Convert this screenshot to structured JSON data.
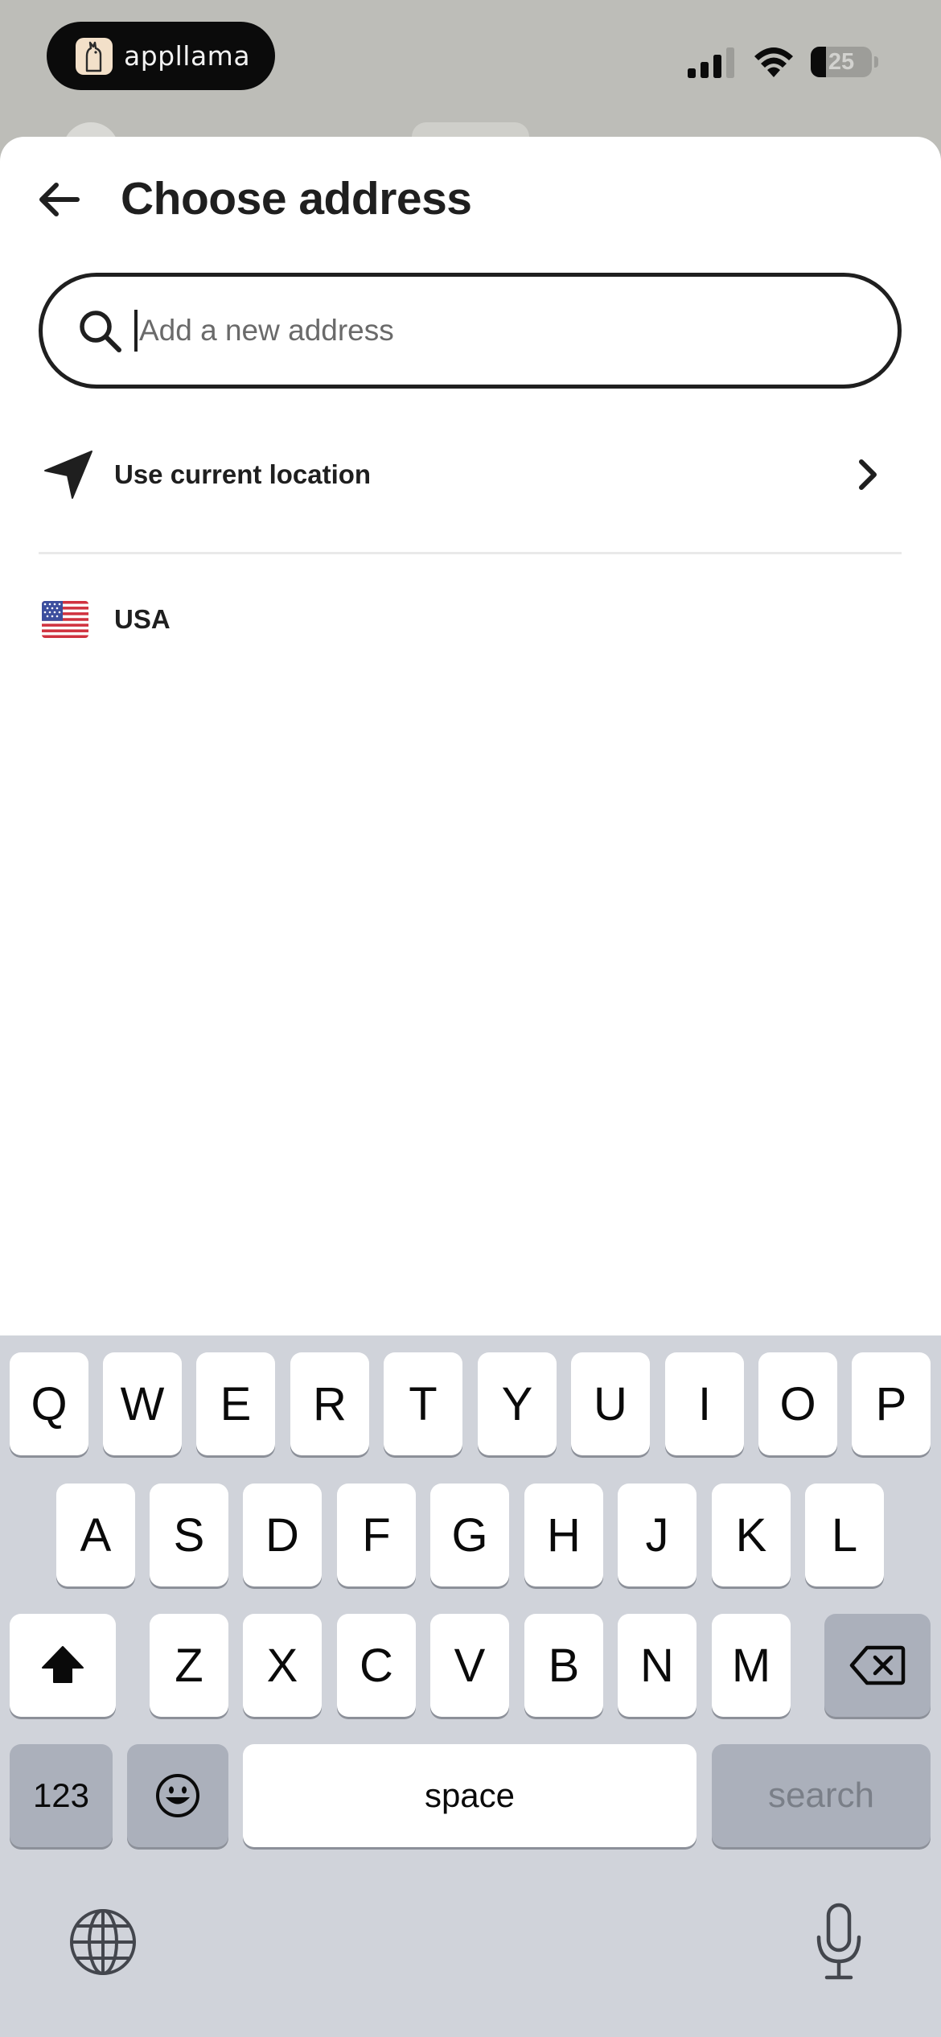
{
  "status_bar": {
    "app_badge_name": "appllama",
    "battery_level": "25",
    "battery_fraction": 0.25,
    "signal_bars_active": 3,
    "signal_bars_total": 4,
    "icons": [
      "llama-logo-icon",
      "cellular-signal-icon",
      "wifi-icon",
      "battery-icon"
    ]
  },
  "header": {
    "back_icon": "arrow-left-icon",
    "title": "Choose address"
  },
  "search": {
    "placeholder": "Add a new address",
    "value": "",
    "icon": "search-icon"
  },
  "options": [
    {
      "label": "Use current location",
      "icon": "location-arrow-icon",
      "trailing_icon": "chevron-right-icon"
    },
    {
      "label": "USA",
      "icon": "us-flag-icon"
    }
  ],
  "keyboard": {
    "row1": [
      "Q",
      "W",
      "E",
      "R",
      "T",
      "Y",
      "U",
      "I",
      "O",
      "P"
    ],
    "row2": [
      "A",
      "S",
      "D",
      "F",
      "G",
      "H",
      "J",
      "K",
      "L"
    ],
    "row3": [
      "Z",
      "X",
      "C",
      "V",
      "B",
      "N",
      "M"
    ],
    "numbers_label": "123",
    "space_label": "space",
    "return_label": "search",
    "icons": [
      "shift-icon",
      "backspace-icon",
      "emoji-icon",
      "globe-icon",
      "microphone-icon"
    ]
  },
  "colors": {
    "text": "#1f1f1f",
    "keyboard_bg": "#d0d3da",
    "key_dark": "#abb0bb",
    "status_bg": "#bdbdb8"
  }
}
